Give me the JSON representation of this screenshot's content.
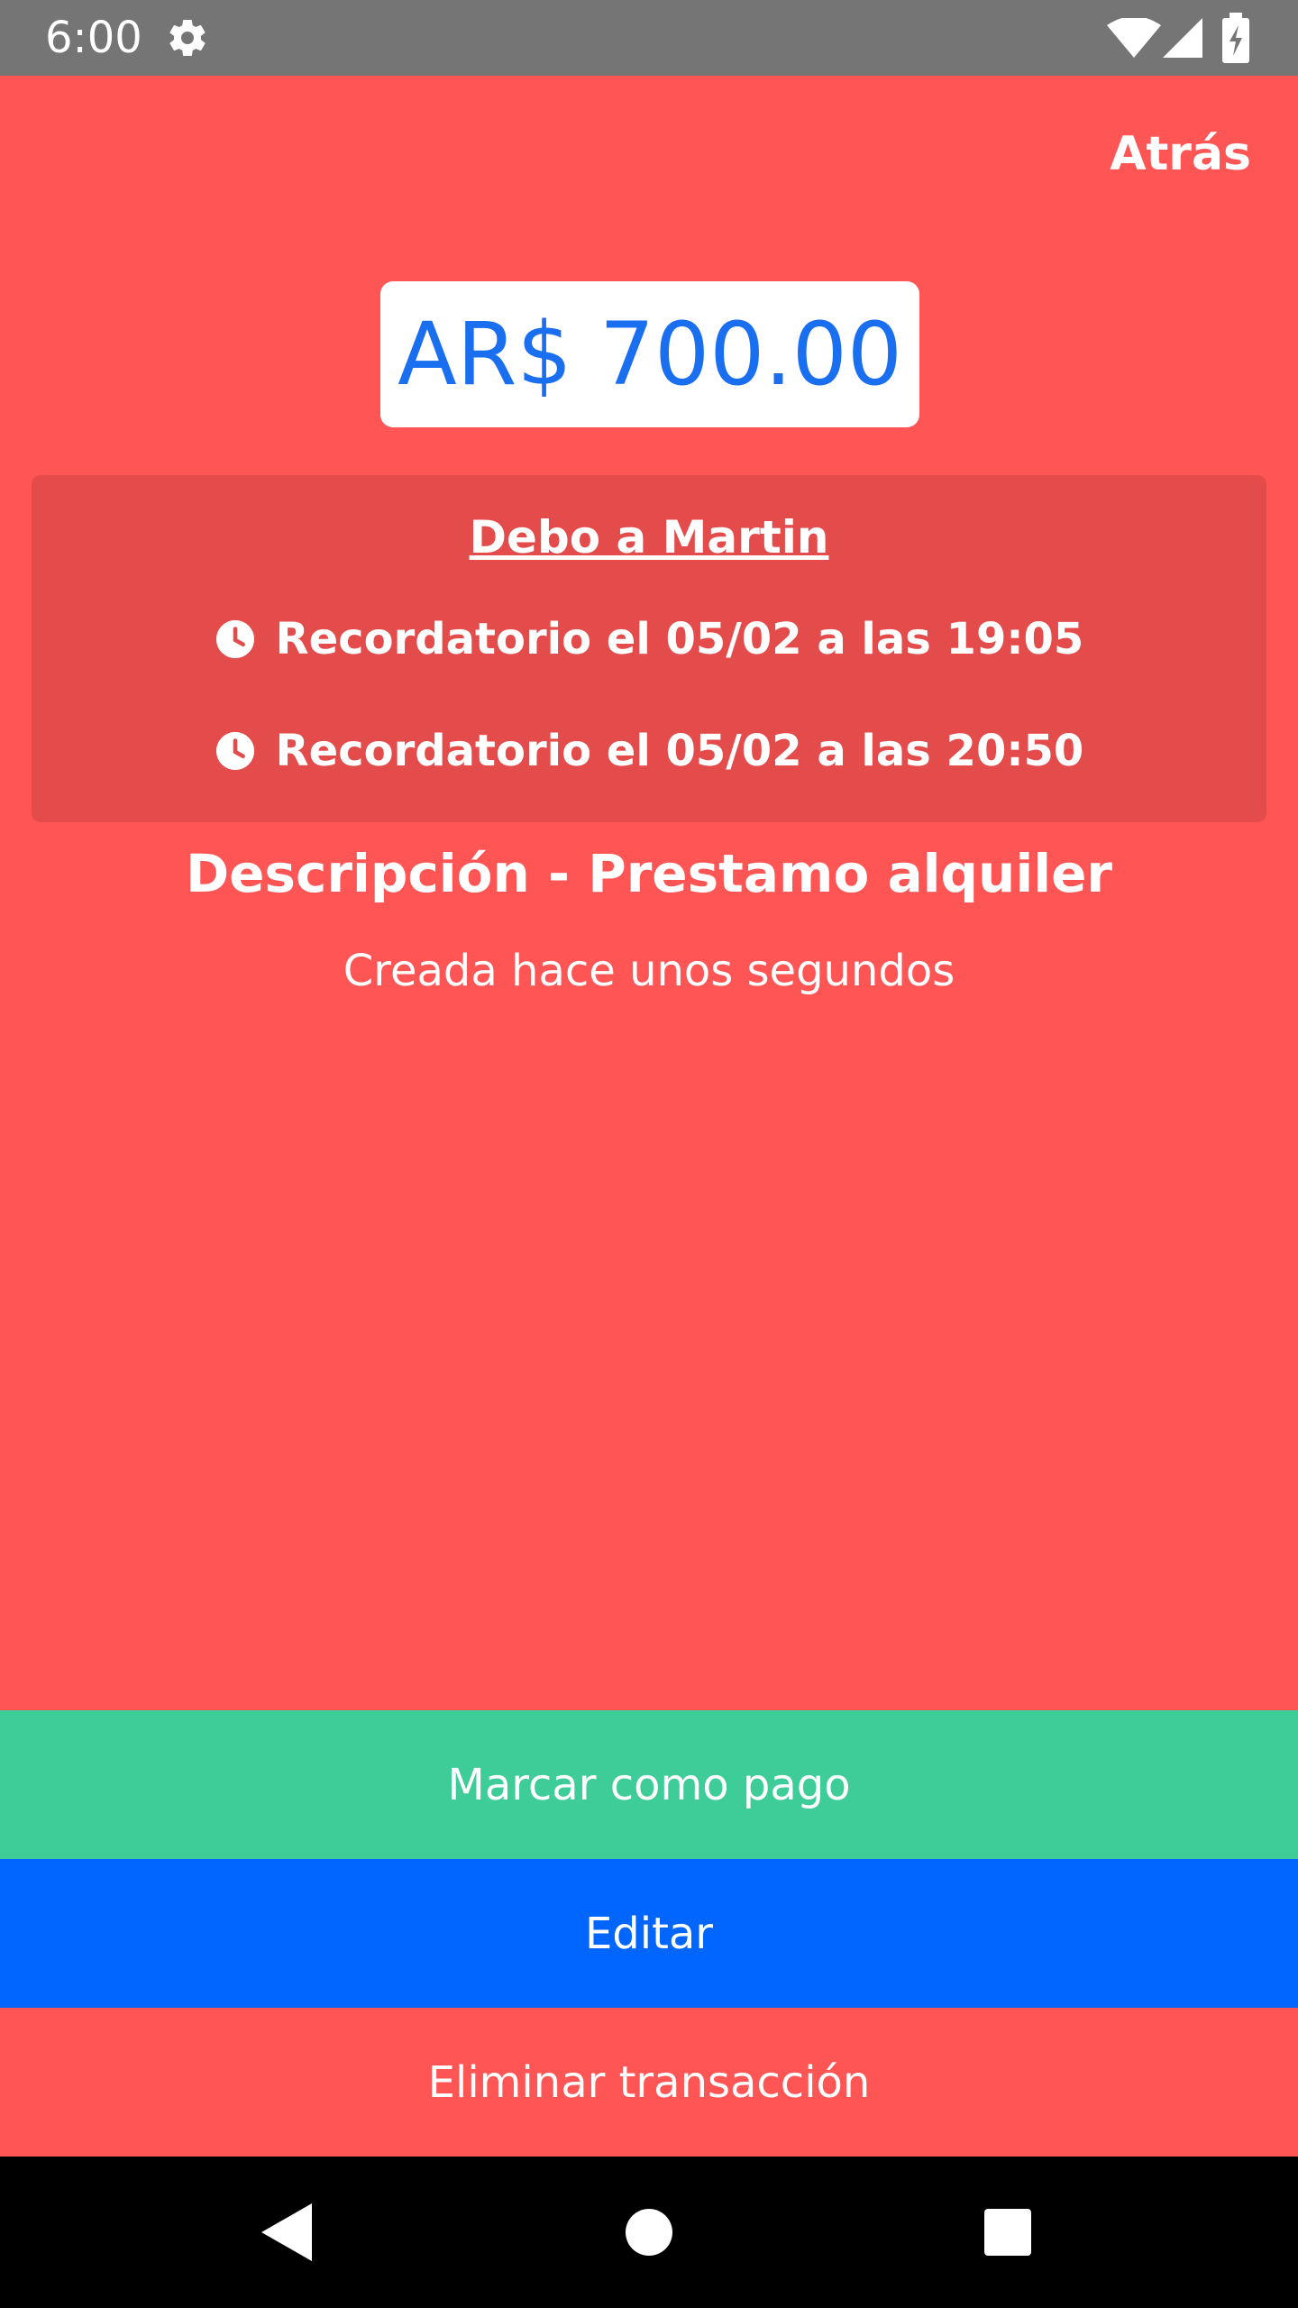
{
  "status_bar": {
    "time": "6:00",
    "icons": [
      "gear-icon",
      "wifi-icon",
      "signal-icon",
      "battery-charging-icon"
    ]
  },
  "header": {
    "back_label": "Atrás"
  },
  "amount": {
    "value": "AR$ 700.00"
  },
  "card": {
    "title": "Debo a Martin",
    "reminders": [
      {
        "icon": "clock-icon",
        "text": "Recordatorio el 05/02 a las 19:05"
      },
      {
        "icon": "clock-icon",
        "text": "Recordatorio el 05/02 a las 20:50"
      }
    ]
  },
  "description": "Descripción - Prestamo alquiler",
  "created": "Creada hace unos segundos",
  "actions": {
    "mark_paid": "Marcar como pago",
    "edit": "Editar",
    "delete": "Eliminar transacción"
  },
  "nav": {
    "icons": [
      "back-triangle-icon",
      "home-circle-icon",
      "recents-square-icon"
    ]
  },
  "colors": {
    "background": "#FF5555",
    "card": "#E44B4B",
    "amount_text": "#1A6FF0",
    "mark_paid": "#3ECC98",
    "edit": "#0066FF",
    "status_bar": "#757575"
  }
}
